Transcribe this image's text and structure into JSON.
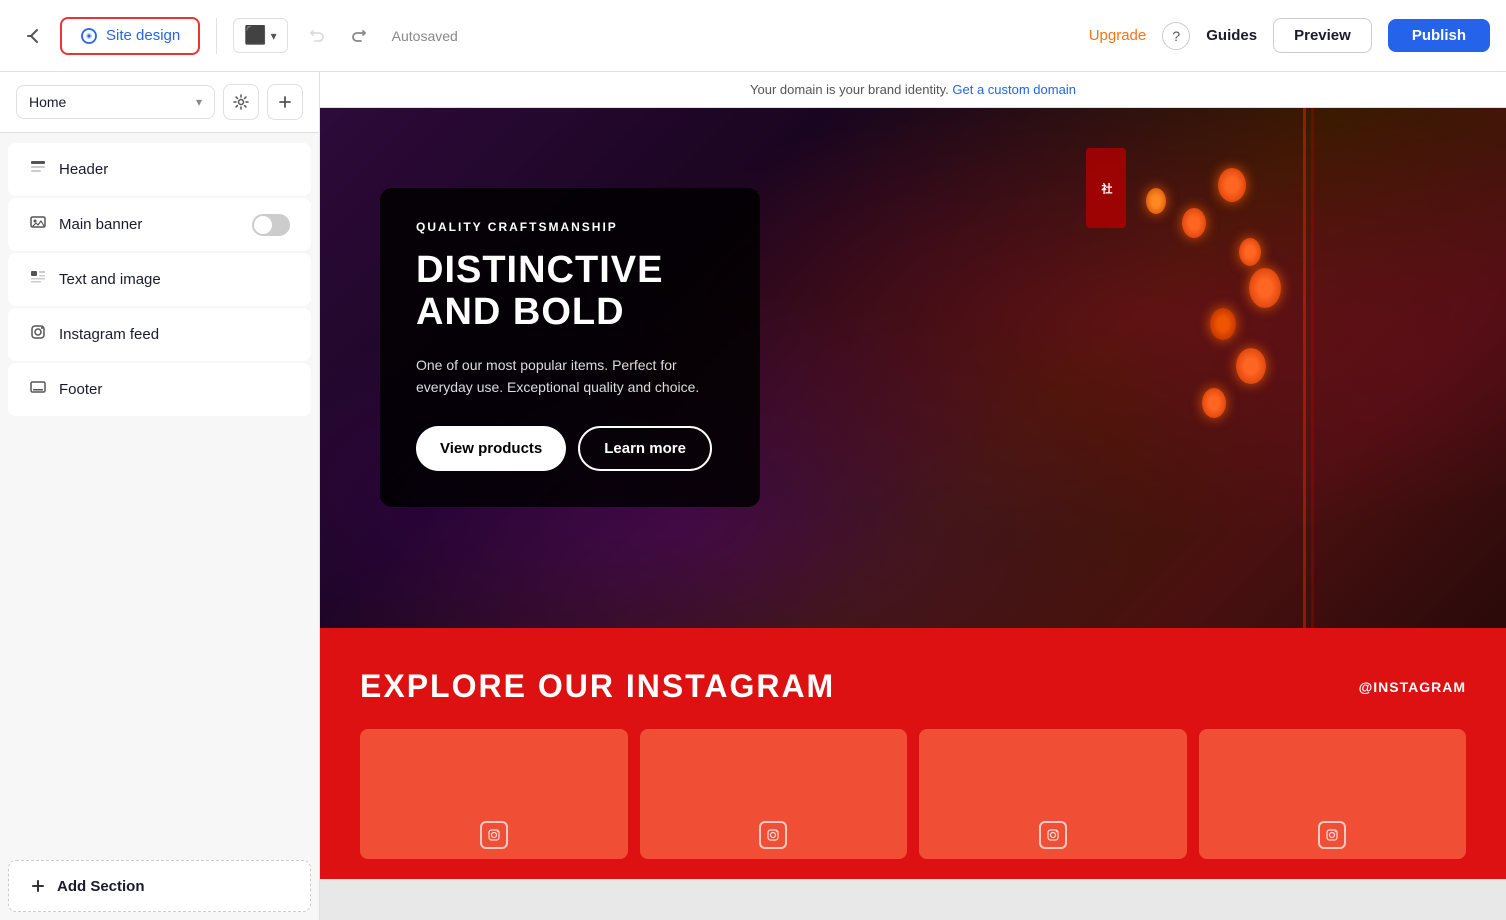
{
  "topbar": {
    "site_design_label": "Site design",
    "upgrade_label": "Upgrade",
    "guides_label": "Guides",
    "preview_label": "Preview",
    "publish_label": "Publish",
    "autosaved_label": "Autosaved",
    "help_icon": "?",
    "exit_icon": "←"
  },
  "page_select": {
    "label": "Home",
    "chevron": "▾"
  },
  "sidebar": {
    "sections": [
      {
        "id": "header",
        "label": "Header",
        "icon": "☰",
        "has_toggle": false
      },
      {
        "id": "main-banner",
        "label": "Main banner",
        "icon": "🔖",
        "has_toggle": true,
        "toggle_on": false
      },
      {
        "id": "text-and-image",
        "label": "Text and image",
        "icon": "▦",
        "has_toggle": false
      },
      {
        "id": "instagram-feed",
        "label": "Instagram feed",
        "icon": "⊙",
        "has_toggle": false
      },
      {
        "id": "footer",
        "label": "Footer",
        "icon": "▬",
        "has_toggle": false
      }
    ],
    "add_section_label": "Add Section"
  },
  "domain_bar": {
    "text": "Your domain is your brand identity.",
    "link_text": "Get a custom domain"
  },
  "hero": {
    "subtitle": "QUALITY CRAFTSMANSHIP",
    "title": "DISTINCTIVE AND BOLD",
    "description": "One of our most popular items. Perfect for everyday use. Exceptional quality and choice.",
    "btn_primary": "View products",
    "btn_secondary": "Learn more"
  },
  "instagram": {
    "title": "EXPLORE OUR INSTAGRAM",
    "handle": "@INSTAGRAM"
  },
  "colors": {
    "primary_blue": "#2563eb",
    "upgrade_orange": "#f97316",
    "instagram_red": "#dd1111",
    "site_design_border": "#e33"
  }
}
